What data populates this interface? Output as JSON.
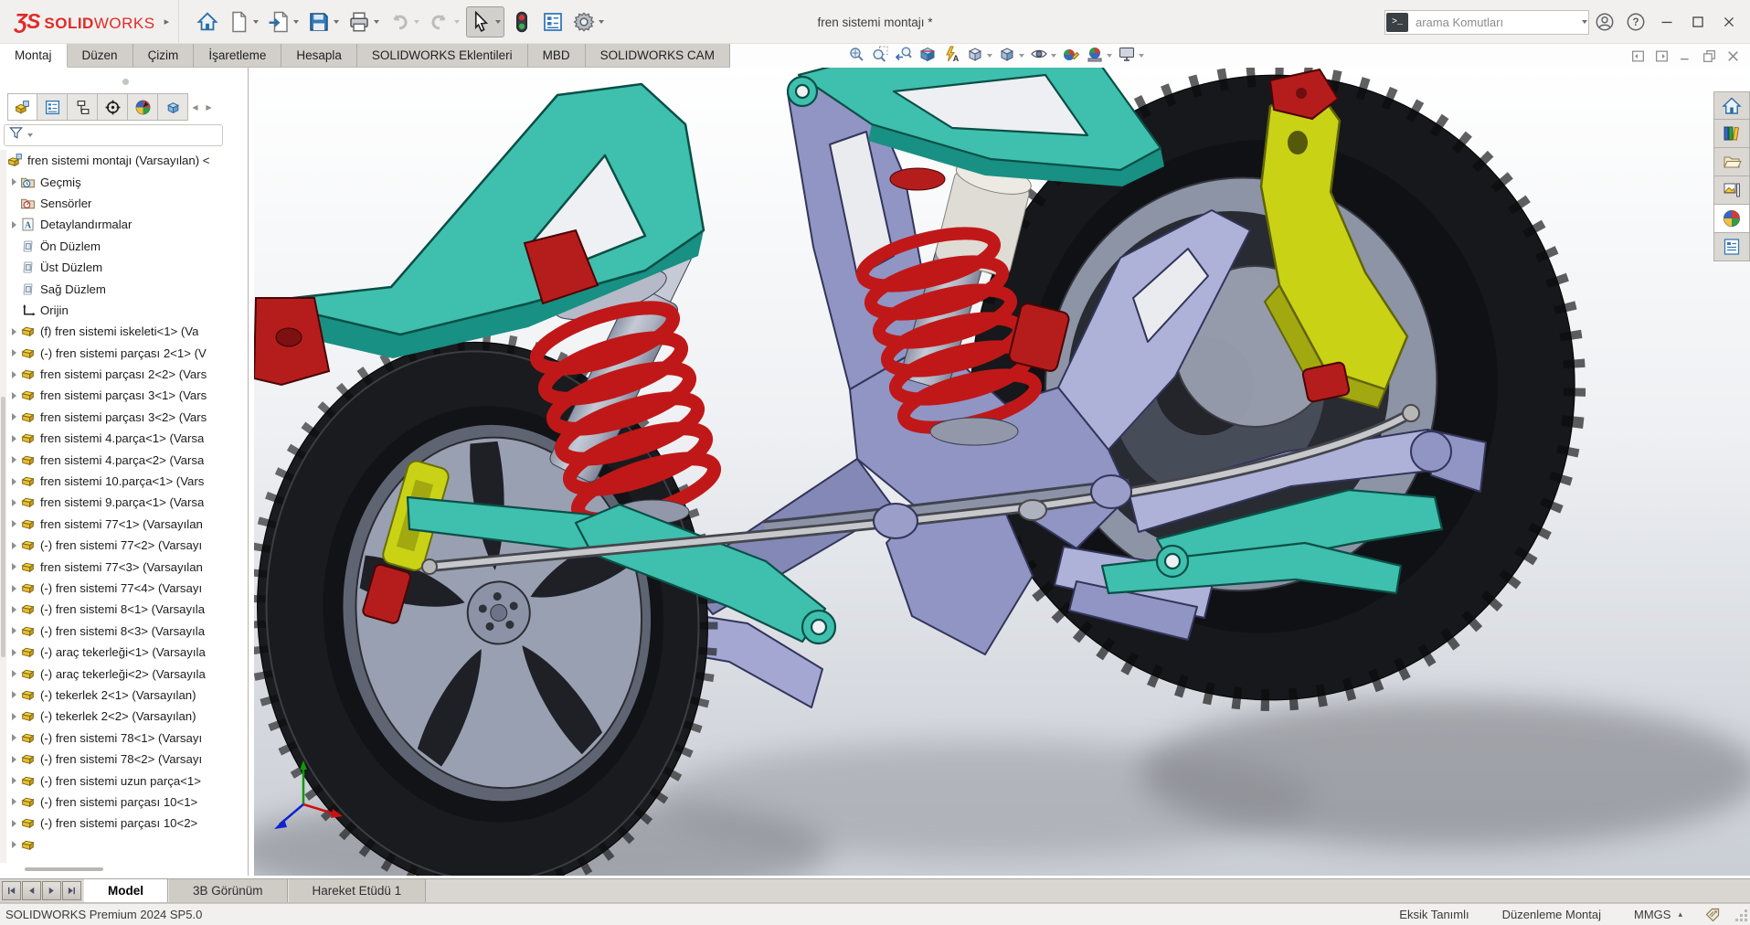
{
  "titlebar": {
    "logo": {
      "mark": "ƷS",
      "bold": "SOLID",
      "light": "WORKS",
      "flyout": "▸"
    },
    "quick_tools": [
      {
        "icon": "home",
        "label": "Home"
      },
      {
        "icon": "new",
        "label": "New",
        "dropdown": true
      },
      {
        "icon": "open",
        "label": "Open",
        "dropdown": true
      },
      {
        "icon": "save",
        "label": "Save",
        "dropdown": true
      },
      {
        "icon": "print",
        "label": "Print",
        "dropdown": true
      },
      {
        "icon": "undo",
        "label": "Undo",
        "dropdown": true,
        "disabled": true
      },
      {
        "icon": "redo",
        "label": "Redo",
        "dropdown": true,
        "disabled": true
      },
      {
        "icon": "select",
        "label": "Select",
        "dropdown": true,
        "pressed": true
      },
      {
        "icon": "rebuild",
        "label": "Rebuild"
      },
      {
        "icon": "fileprops",
        "label": "File Properties"
      },
      {
        "icon": "gear",
        "label": "Options",
        "dropdown": true
      }
    ],
    "document_title": "fren sistemi montajı *",
    "search": {
      "terminal_glyph": ">_",
      "placeholder": "arama Komutları"
    }
  },
  "ribbon": {
    "tabs": [
      {
        "label": "Montaj",
        "active": true
      },
      {
        "label": "Düzen"
      },
      {
        "label": "Çizim"
      },
      {
        "label": "İşaretleme"
      },
      {
        "label": "Hesapla"
      },
      {
        "label": "SOLIDWORKS Eklentileri"
      },
      {
        "label": "MBD"
      },
      {
        "label": "SOLIDWORKS CAM"
      }
    ]
  },
  "headsup_tools": [
    {
      "icon": "zoomfit",
      "name": "zoom-to-fit"
    },
    {
      "icon": "zoomarea",
      "name": "zoom-to-area"
    },
    {
      "icon": "prevview",
      "name": "previous-view"
    },
    {
      "icon": "section",
      "name": "section-view"
    },
    {
      "icon": "annviews",
      "name": "dynamic-annotation-views"
    },
    {
      "icon": "vieworient",
      "name": "view-orientation",
      "dropdown": true
    },
    {
      "icon": "dispstyle",
      "name": "display-style",
      "dropdown": true
    },
    {
      "icon": "hideshow",
      "name": "hide-show-items",
      "dropdown": true
    },
    {
      "icon": "editappear",
      "name": "edit-appearance"
    },
    {
      "icon": "scene",
      "name": "apply-scene",
      "dropdown": true
    },
    {
      "icon": "viewsettings",
      "name": "view-settings",
      "dropdown": true
    }
  ],
  "doc_window_controls": [
    {
      "icon": "paneleft",
      "name": "collapse-pane-left"
    },
    {
      "icon": "paneright",
      "name": "collapse-pane-right"
    },
    {
      "icon": "docmin",
      "name": "document-minimize"
    },
    {
      "icon": "docrestore",
      "name": "document-restore"
    },
    {
      "icon": "docclose",
      "name": "document-close"
    }
  ],
  "feature_panel": {
    "tabs": [
      {
        "icon": "featuremanager",
        "name": "featuremanager-tree-tab",
        "active": true
      },
      {
        "icon": "propertymanager",
        "name": "propertymanager-tab"
      },
      {
        "icon": "configurationmanager",
        "name": "configurationmanager-tab"
      },
      {
        "icon": "dimxpertmanager",
        "name": "dimxpertmanager-tab"
      },
      {
        "icon": "displaymanager",
        "name": "displaymanager-tab"
      },
      {
        "icon": "camtree",
        "name": "cam-tree-tab"
      }
    ],
    "tab_scroll_arrows": [
      "◀",
      "▶"
    ],
    "tree": [
      {
        "icon": "assembly",
        "label": "fren sistemi montajı (Varsayılan) <",
        "root": true
      },
      {
        "icon": "history",
        "label": "Geçmiş",
        "arrow": true
      },
      {
        "icon": "sensors",
        "label": "Sensörler"
      },
      {
        "icon": "annotations",
        "label": "Detaylandırmalar",
        "arrow": true
      },
      {
        "icon": "plane",
        "label": "Ön Düzlem"
      },
      {
        "icon": "plane",
        "label": "Üst Düzlem"
      },
      {
        "icon": "plane",
        "label": "Sağ Düzlem"
      },
      {
        "icon": "origin",
        "label": "Orijin"
      },
      {
        "icon": "part",
        "arrow": true,
        "label": "(f) fren sistemi iskeleti<1> (Va"
      },
      {
        "icon": "part",
        "arrow": true,
        "label": "(-) fren sistemi parçası 2<1> (V"
      },
      {
        "icon": "part",
        "arrow": true,
        "label": "fren sistemi parçası 2<2> (Vars"
      },
      {
        "icon": "part",
        "arrow": true,
        "label": "fren sistemi parçası 3<1> (Vars"
      },
      {
        "icon": "part",
        "arrow": true,
        "label": "fren sistemi parçası 3<2> (Vars"
      },
      {
        "icon": "part",
        "arrow": true,
        "label": "fren sistemi  4.parça<1> (Varsa"
      },
      {
        "icon": "part",
        "arrow": true,
        "label": "fren sistemi  4.parça<2> (Varsa"
      },
      {
        "icon": "part",
        "arrow": true,
        "label": "fren sistemi 10.parça<1> (Vars"
      },
      {
        "icon": "part",
        "arrow": true,
        "label": "fren sistemi 9.parça<1> (Varsa"
      },
      {
        "icon": "part",
        "arrow": true,
        "label": "fren sistemi 77<1> (Varsayılan"
      },
      {
        "icon": "part",
        "arrow": true,
        "label": "(-) fren sistemi 77<2> (Varsayı"
      },
      {
        "icon": "part",
        "arrow": true,
        "label": "fren sistemi 77<3> (Varsayılan"
      },
      {
        "icon": "part",
        "arrow": true,
        "label": "(-) fren sistemi 77<4> (Varsayı"
      },
      {
        "icon": "part",
        "arrow": true,
        "label": "(-) fren sistemi 8<1> (Varsayıla"
      },
      {
        "icon": "part",
        "arrow": true,
        "label": "(-) fren sistemi 8<3> (Varsayıla"
      },
      {
        "icon": "part",
        "arrow": true,
        "label": "(-) araç tekerleği<1> (Varsayıla"
      },
      {
        "icon": "part",
        "arrow": true,
        "label": "(-) araç tekerleği<2> (Varsayıla"
      },
      {
        "icon": "part",
        "arrow": true,
        "label": "(-) tekerlek 2<1> (Varsayılan)"
      },
      {
        "icon": "part",
        "arrow": true,
        "label": "(-) tekerlek 2<2> (Varsayılan)"
      },
      {
        "icon": "part",
        "arrow": true,
        "label": "(-) fren sistemi 78<1> (Varsayı"
      },
      {
        "icon": "part",
        "arrow": true,
        "label": "(-) fren sistemi 78<2> (Varsayı"
      },
      {
        "icon": "part",
        "arrow": true,
        "label": "(-) fren sistemi uzun parça<1>"
      },
      {
        "icon": "part",
        "arrow": true,
        "label": "(-) fren sistemi parçası 10<1>"
      },
      {
        "icon": "part",
        "arrow": true,
        "label": "(-) fren sistemi parçası 10<2>"
      },
      {
        "icon": "part",
        "arrow": true,
        "label": ""
      }
    ]
  },
  "viewport": {
    "model_name": "fren sistemi montajı",
    "colors": {
      "teal": "#3fbfae",
      "teal_dark": "#189083",
      "lavender": "#aeb1d8",
      "lavender_mid": "#9095c4",
      "lavender_dark": "#8388b6",
      "spring_red": "#c01818",
      "accent_red": "#b51d1d",
      "knuckle_yellow": "#c9d215",
      "knuckle_dark": "#a2a80f",
      "rim_gray": "#99a0b2",
      "tire_black": "#17181b"
    }
  },
  "task_pane": [
    {
      "icon": "tphome",
      "name": "taskpane-home-tab"
    },
    {
      "icon": "tplibrary",
      "name": "taskpane-design-library-tab"
    },
    {
      "icon": "tpexplorer",
      "name": "taskpane-file-explorer-tab"
    },
    {
      "icon": "tppalette",
      "name": "taskpane-view-palette-tab"
    },
    {
      "icon": "tpappearance",
      "name": "taskpane-appearances-scenes-tab",
      "active": true
    },
    {
      "icon": "tpprops",
      "name": "taskpane-custom-properties-tab"
    }
  ],
  "bottom_bar": {
    "nav": [
      {
        "icon": "navfirst",
        "name": "first-tab-button"
      },
      {
        "icon": "navprev",
        "name": "previous-tab-button"
      },
      {
        "icon": "navnext",
        "name": "next-tab-button"
      },
      {
        "icon": "navlast",
        "name": "last-tab-button"
      }
    ],
    "tabs": [
      {
        "label": "Model",
        "active": true
      },
      {
        "label": "3B Görünüm"
      },
      {
        "label": "Hareket Etüdü 1"
      }
    ]
  },
  "statusbar": {
    "left": "SOLIDWORKS Premium 2024 SP5.0",
    "status": "Eksik Tanımlı",
    "mode": "Düzenleme Montaj",
    "units": "MMGS",
    "units_caret": "▴"
  }
}
